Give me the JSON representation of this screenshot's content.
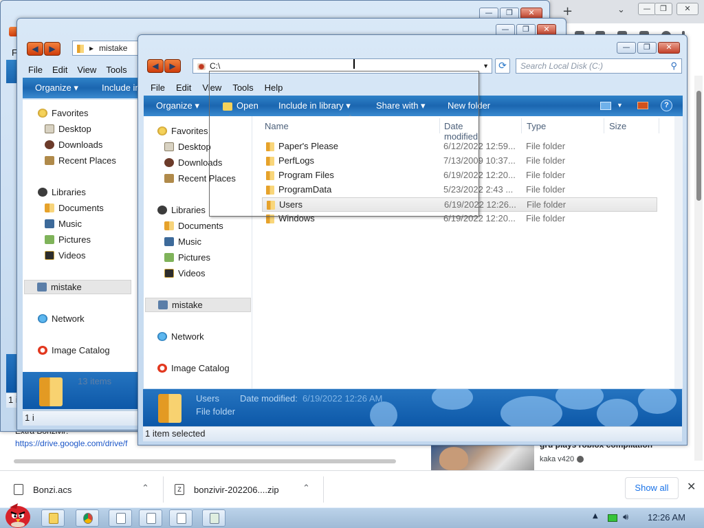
{
  "browser": {
    "new_tab_label": "+",
    "tab_dropdown_label": "⌄",
    "window_controls": [
      "—",
      "❐",
      "✕"
    ],
    "page_link_label": "Extra Bonzivir:",
    "page_link": "https://drive.google.com/drive/f",
    "video": {
      "title": "gru plays roblox compilation",
      "channel": "kaka v420"
    }
  },
  "downloads": {
    "items": [
      {
        "name": "Bonzi.acs",
        "chevron": "⌃"
      },
      {
        "name": "bonzivir-202206....zip",
        "chevron": "⌃"
      }
    ],
    "show_all_label": "Show all",
    "close_label": "✕"
  },
  "taskbar": {
    "clock": "12:26 AM",
    "tray_up": "▲"
  },
  "back_window": {
    "controls": [
      "—",
      "❐",
      "✕"
    ],
    "menu": [
      "F"
    ],
    "status": "1 i"
  },
  "middle_window": {
    "address": "mistake",
    "controls": [
      "—",
      "❐",
      "✕"
    ],
    "menu": [
      "File",
      "Edit",
      "View",
      "Tools"
    ],
    "commands": {
      "organize": "Organize ▾",
      "include": "Include in"
    },
    "nav": {
      "favorites": "Favorites",
      "desktop": "Desktop",
      "downloads": "Downloads",
      "recent": "Recent Places",
      "libraries": "Libraries",
      "documents": "Documents",
      "music": "Music",
      "pictures": "Pictures",
      "videos": "Videos",
      "home": "mistake",
      "network": "Network",
      "catalog": "Image Catalog"
    },
    "detail_count": "13 items",
    "status": "1 i"
  },
  "front_window": {
    "address": "C:\\",
    "search_placeholder": "Search Local Disk (C:)",
    "controls": [
      "—",
      "❐",
      "✕"
    ],
    "menu": [
      "File",
      "Edit",
      "View",
      "Tools",
      "Help"
    ],
    "commands": {
      "organize": "Organize ▾",
      "open": "Open",
      "include": "Include in library ▾",
      "share": "Share with ▾",
      "new_folder": "New folder",
      "help": "?"
    },
    "nav": {
      "favorites": "Favorites",
      "desktop": "Desktop",
      "downloads": "Downloads",
      "recent": "Recent Places",
      "libraries": "Libraries",
      "documents": "Documents",
      "music": "Music",
      "pictures": "Pictures",
      "videos": "Videos",
      "home": "mistake",
      "network": "Network",
      "catalog": "Image Catalog"
    },
    "columns": {
      "name": "Name",
      "date": "Date modified",
      "type": "Type",
      "size": "Size"
    },
    "files": [
      {
        "name": "Paper's Please",
        "date": "6/12/2022 12:59...",
        "type": "File folder"
      },
      {
        "name": "PerfLogs",
        "date": "7/13/2009 10:37...",
        "type": "File folder"
      },
      {
        "name": "Program Files",
        "date": "6/19/2022 12:20...",
        "type": "File folder"
      },
      {
        "name": "ProgramData",
        "date": "5/23/2022 2:43 ...",
        "type": "File folder"
      },
      {
        "name": "Users",
        "date": "6/19/2022 12:26...",
        "type": "File folder"
      },
      {
        "name": "Windows",
        "date": "6/19/2022 12:20...",
        "type": "File folder"
      }
    ],
    "selected_file_index": 4,
    "details": {
      "name": "Users",
      "date_label": "Date modified:",
      "date_value": "6/19/2022 12:26 AM",
      "kind": "File folder"
    },
    "status": "1 item selected"
  },
  "colors": {
    "command_bar": "#1b66b0",
    "nav_arrow": "#e2581f",
    "close_button": "#c3412a",
    "link": "#1a55c7"
  }
}
